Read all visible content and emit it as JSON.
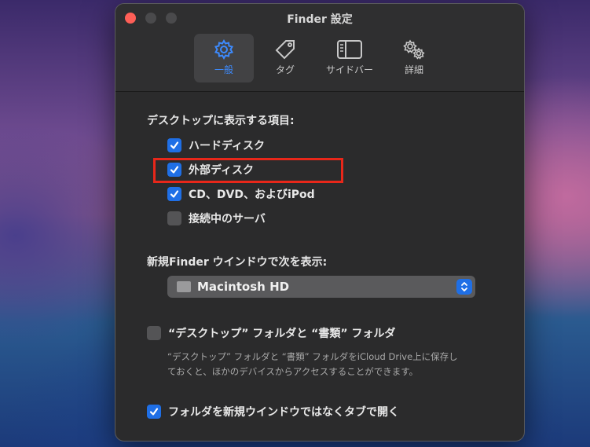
{
  "window": {
    "title": "Finder 設定"
  },
  "toolbar": {
    "tabs": [
      {
        "label": "一般",
        "icon": "gear-icon",
        "active": true
      },
      {
        "label": "タグ",
        "icon": "tag-icon",
        "active": false
      },
      {
        "label": "サイドバー",
        "icon": "sidebar-icon",
        "active": false
      },
      {
        "label": "詳細",
        "icon": "gears-icon",
        "active": false
      }
    ]
  },
  "desktop_section": {
    "heading": "デスクトップに表示する項目:",
    "items": [
      {
        "label": "ハードディスク",
        "checked": true
      },
      {
        "label": "外部ディスク",
        "checked": true
      },
      {
        "label": "CD、DVD、およびiPod",
        "checked": true
      },
      {
        "label": "接続中のサーバ",
        "checked": false
      }
    ]
  },
  "new_window_section": {
    "heading": "新規Finder ウインドウで次を表示:",
    "selected": "Macintosh HD"
  },
  "icloud_option": {
    "label": "“デスクトップ” フォルダと “書類” フォルダ",
    "checked": false,
    "description": "“デスクトップ” フォルダと “書類” フォルダをiCloud Drive上に保存しておくと、ほかのデバイスからアクセスすることができます。"
  },
  "tabs_option": {
    "label": "フォルダを新規ウインドウではなくタブで開く",
    "checked": true
  },
  "colors": {
    "accent": "#1f6fe6",
    "highlight": "#e8271a",
    "window_bg": "#2b2b2c"
  }
}
